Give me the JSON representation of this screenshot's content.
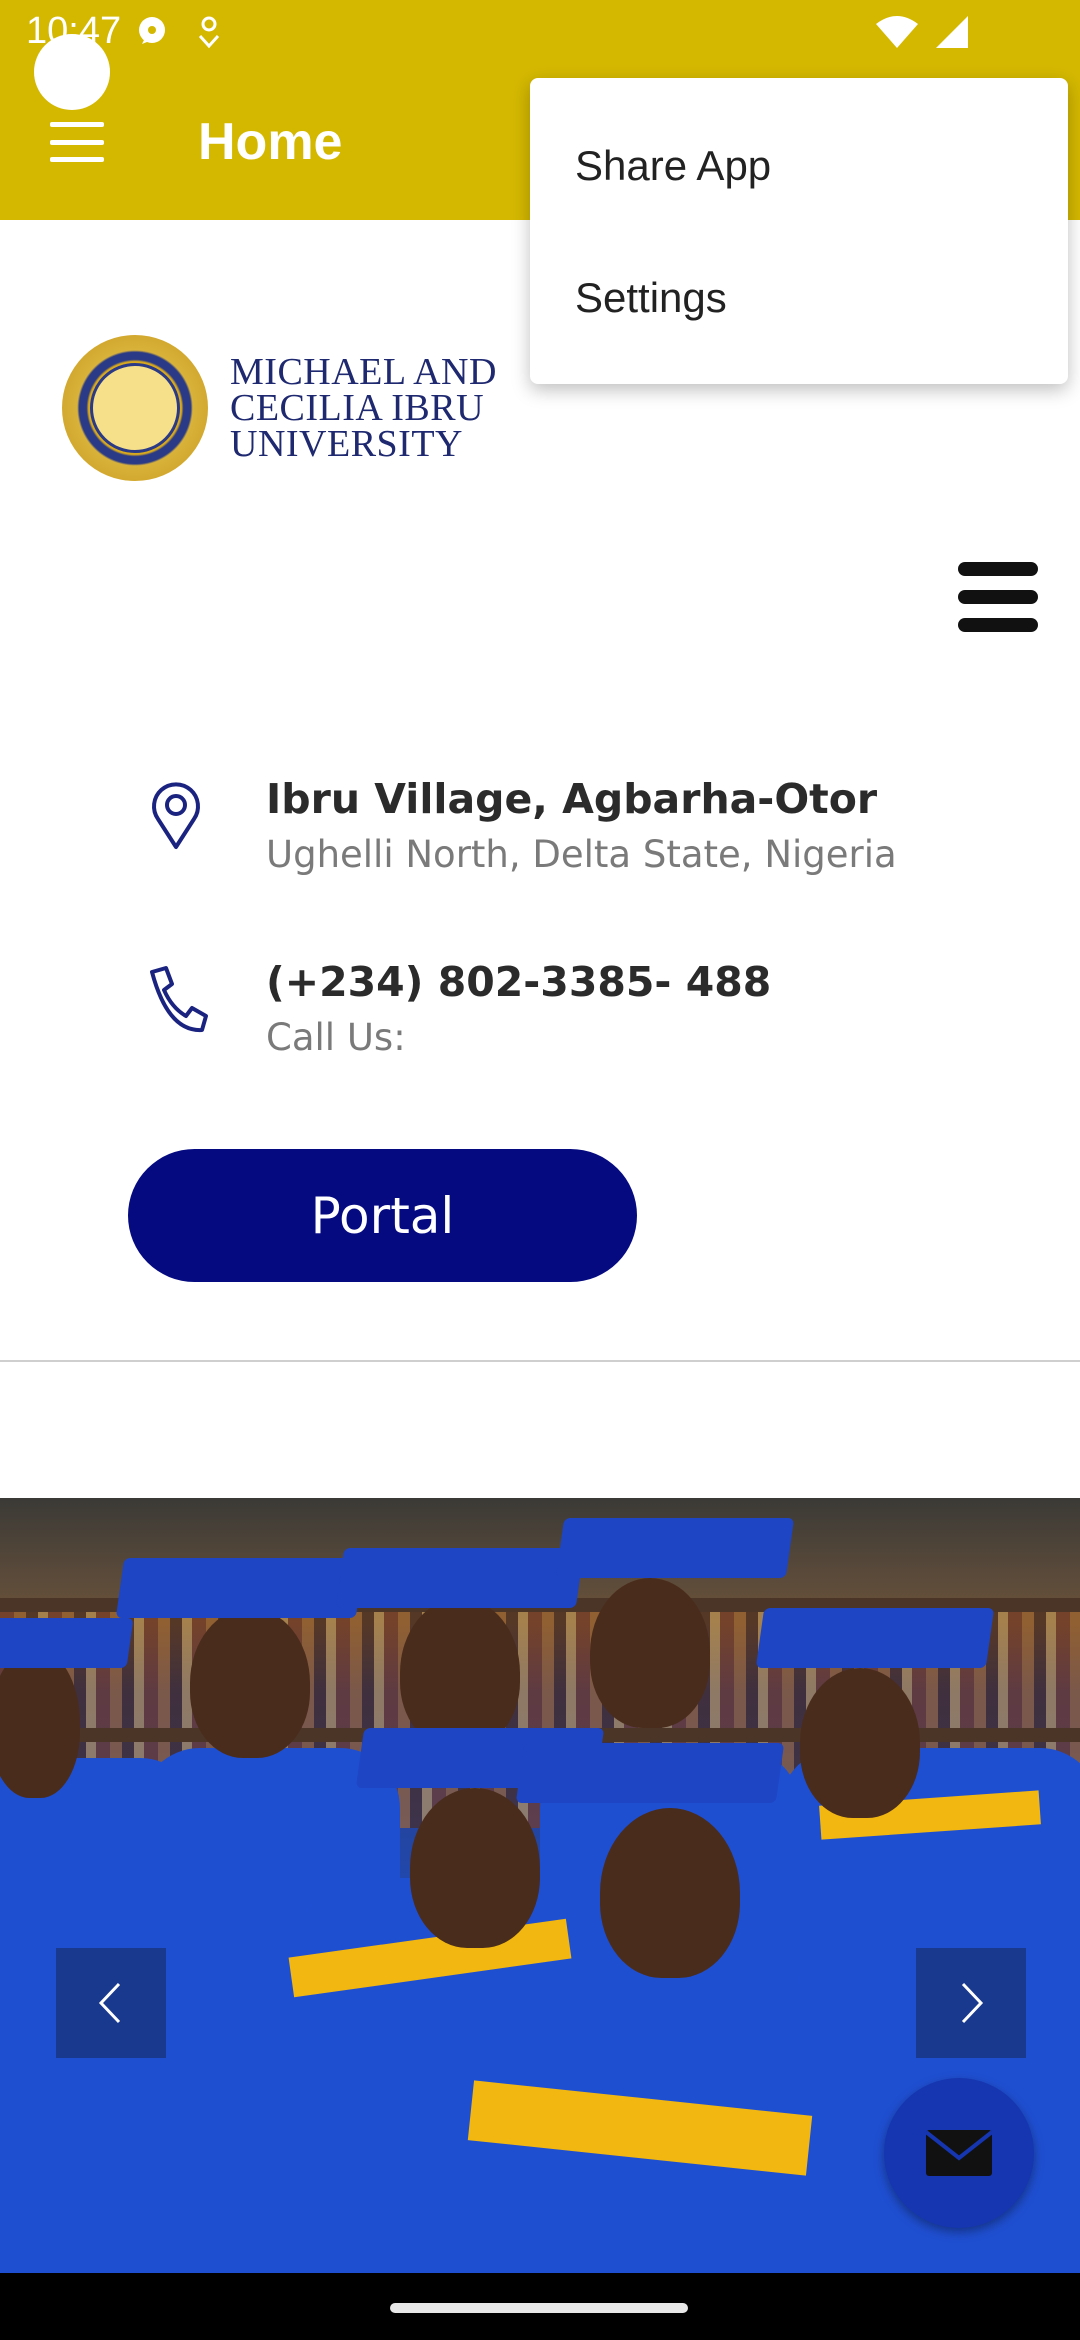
{
  "status_bar": {
    "time": "10:47"
  },
  "app_bar": {
    "title": "Home"
  },
  "overflow_menu": {
    "items": [
      "Share App",
      "Settings"
    ]
  },
  "logo": {
    "line1": "MICHAEL AND",
    "line2": "CECILIA IBRU",
    "line3": "UNIVERSITY"
  },
  "contact": {
    "address_main": "Ibru Village, Agbarha-Otor",
    "address_sub": "Ughelli North, Delta State, Nigeria",
    "phone_main": "(+234) 802-3385- 488",
    "phone_sub": "Call Us:"
  },
  "portal_button": {
    "label": "Portal"
  },
  "colors": {
    "app_bar": "#d4b800",
    "portal_button": "#050a80",
    "fab": "#1536b0"
  },
  "icons": {
    "menu": "hamburger-icon",
    "location": "location-pin-icon",
    "phone": "phone-icon",
    "prev": "chevron-left-icon",
    "next": "chevron-right-icon",
    "mail": "mail-icon"
  }
}
